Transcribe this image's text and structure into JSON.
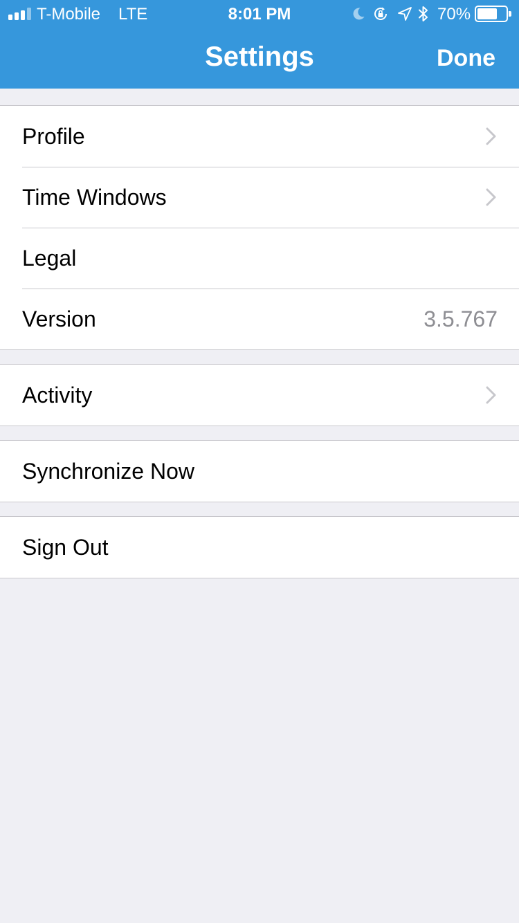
{
  "status_bar": {
    "carrier": "T-Mobile",
    "network": "LTE",
    "time": "8:01 PM",
    "battery_percent": "70%",
    "battery_level": 0.7,
    "signal_bars_active": 3,
    "signal_bars_total": 4,
    "icons": [
      "moon-icon",
      "rotation-lock-icon",
      "location-icon",
      "bluetooth-icon",
      "battery-icon"
    ]
  },
  "nav": {
    "title": "Settings",
    "done_label": "Done"
  },
  "groups": {
    "general": {
      "items": [
        {
          "label": "Profile",
          "chevron": true
        },
        {
          "label": "Time Windows",
          "chevron": true
        },
        {
          "label": "Legal",
          "chevron": false
        },
        {
          "label": "Version",
          "detail": "3.5.767",
          "chevron": false
        }
      ]
    },
    "activity": {
      "items": [
        {
          "label": "Activity",
          "chevron": true
        }
      ]
    },
    "sync": {
      "items": [
        {
          "label": "Synchronize Now",
          "chevron": false
        }
      ]
    },
    "account": {
      "items": [
        {
          "label": "Sign Out",
          "chevron": false
        }
      ]
    }
  },
  "colors": {
    "nav_background": "#3697dc",
    "page_background": "#efeff4",
    "separator": "#c8c7cc",
    "detail_text": "#8e8e93",
    "chevron": "#c7c7cc"
  }
}
